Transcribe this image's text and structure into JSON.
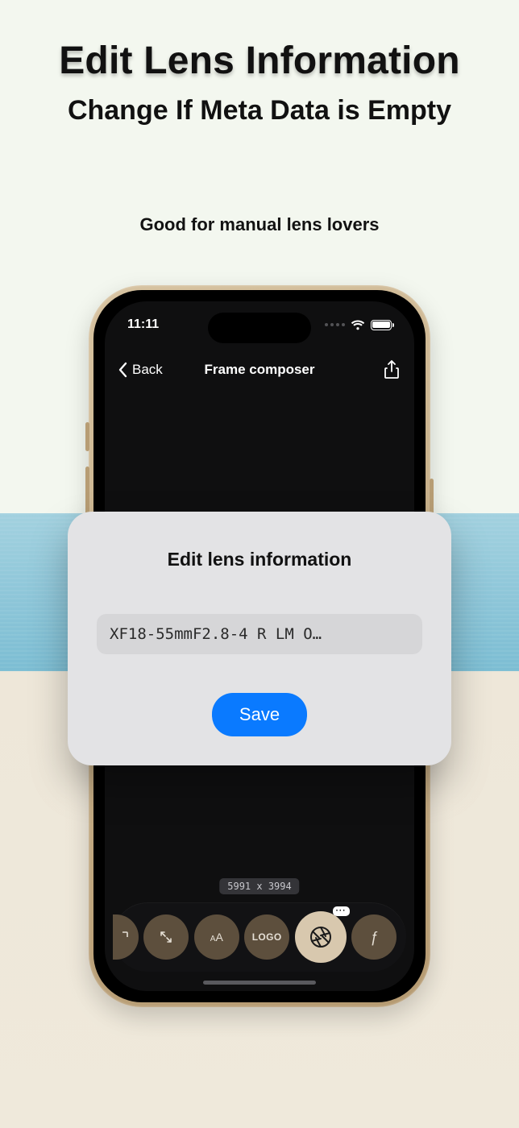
{
  "marketing": {
    "headline": "Edit Lens Information",
    "subhead": "Change If Meta Data is Empty",
    "tagline": "Good for manual lens lovers"
  },
  "status": {
    "time": "11:11"
  },
  "nav": {
    "back": "Back",
    "title": "Frame composer"
  },
  "canvas": {
    "dimensions": "5991 x 3994"
  },
  "toolbar": {
    "font_label": "A",
    "font_label_small": "A",
    "logo_label": "LOGO",
    "function_label": "ƒ",
    "aperture_badge": "···"
  },
  "sheet": {
    "title": "Edit lens information",
    "lens_value": "XF18-55mmF2.8-4 R LM O…",
    "save_label": "Save"
  }
}
